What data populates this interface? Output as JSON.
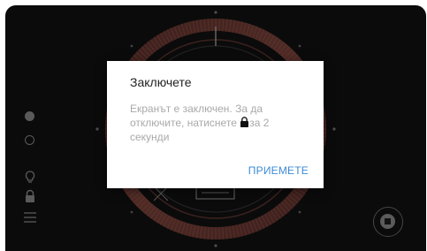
{
  "dialog": {
    "title": "Заключете",
    "message_before_icon": "Екранът е заключен. За да отключите, натиснете ",
    "message_icon": "lock-icon",
    "message_after_icon": "за 2 секунди",
    "action_label": "ПРИЕМЕТЕ"
  },
  "left_rail": {
    "items": [
      {
        "icon": "filled-circle-icon"
      },
      {
        "icon": "empty-circle-icon"
      },
      {
        "icon": "lightbulb-icon"
      },
      {
        "icon": "lock-icon"
      },
      {
        "icon": "menu-icon"
      }
    ]
  },
  "controls": {
    "stop_icon": "stop-icon"
  },
  "colors": {
    "background": "#111111",
    "dial_ring": "#6b3a34",
    "dial_ticks": "#8a4a42",
    "dialog_background": "#ffffff",
    "accent": "#3d8bd6",
    "muted_text": "#a9a9a9"
  }
}
